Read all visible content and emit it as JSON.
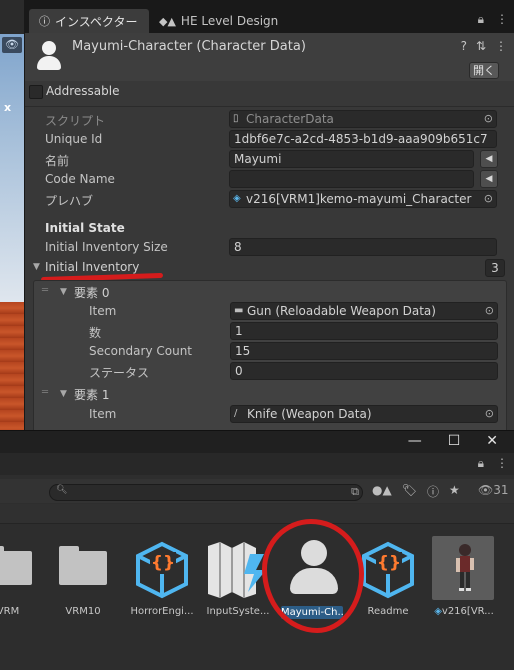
{
  "inspector": {
    "tabs": [
      {
        "label": "インスペクター",
        "icon": "info-icon"
      },
      {
        "label": "HE Level Design",
        "icon": "shapes-icon"
      }
    ],
    "title": "Mayumi-Character (Character Data)",
    "open_button": "開く",
    "addressable_label": "Addressable",
    "fields": {
      "script_label": "スクリプト",
      "script_value": "CharacterData",
      "unique_id_label": "Unique Id",
      "unique_id_value": "1dbf6e7c-a2cd-4853-b1d9-aaa909b651c7",
      "name_label": "名前",
      "name_value": "Mayumi",
      "code_name_label": "Code Name",
      "code_name_value": "",
      "prefab_label": "プレハブ",
      "prefab_value": "v216[VRM1]kemo-mayumi_Character"
    },
    "section_title": "Initial State",
    "initial_inventory_size_label": "Initial Inventory Size",
    "initial_inventory_size_value": "8",
    "initial_inventory_label": "Initial Inventory",
    "initial_inventory_count": "3",
    "elements": [
      {
        "header": "要素 0",
        "item_label": "Item",
        "item_value": "Gun (Reloadable Weapon Data)",
        "count_label": "数",
        "count_value": "1",
        "secondary_label": "Secondary Count",
        "secondary_value": "15",
        "status_label": "ステータス",
        "status_value": "0"
      },
      {
        "header": "要素 1",
        "item_label": "Item",
        "item_value": "Knife (Weapon Data)"
      }
    ]
  },
  "project": {
    "hidden_count": "31",
    "search_value": "",
    "assets": [
      {
        "label": "VRM",
        "kind": "folder"
      },
      {
        "label": "VRM10",
        "kind": "folder"
      },
      {
        "label": "HorrorEngi...",
        "kind": "script"
      },
      {
        "label": "InputSyste...",
        "kind": "input-actions"
      },
      {
        "label": "Mayumi-Ch...",
        "kind": "character-data",
        "selected": true
      },
      {
        "label": "Readme",
        "kind": "script"
      },
      {
        "label": "v216[VR...",
        "kind": "prefab"
      }
    ]
  },
  "colors": {
    "accent_selection": "#2c5d87",
    "annotation_red": "#d51c1c",
    "script_orange": "#ff7a2f",
    "script_blue": "#4fb6f0"
  }
}
